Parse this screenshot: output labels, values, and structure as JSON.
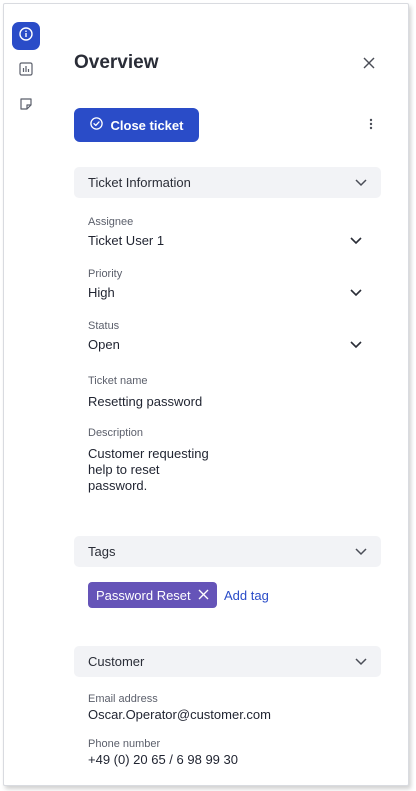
{
  "rail": {
    "items": [
      {
        "icon": "info-icon",
        "active": true
      },
      {
        "icon": "chart-icon",
        "active": false
      },
      {
        "icon": "sticky-note-icon",
        "active": false
      }
    ]
  },
  "panel": {
    "title": "Overview",
    "close_ticket_label": "Close ticket"
  },
  "ticket_information": {
    "heading": "Ticket Information",
    "assignee_label": "Assignee",
    "assignee_value": "Ticket User 1",
    "priority_label": "Priority",
    "priority_value": "High",
    "status_label": "Status",
    "status_value": "Open",
    "ticket_name_label": "Ticket name",
    "ticket_name_value": "Resetting password",
    "description_label": "Description",
    "description_lines": [
      "Customer requesting",
      "help to reset",
      "password."
    ]
  },
  "tags": {
    "heading": "Tags",
    "items": [
      "Password Reset"
    ],
    "add_label": "Add tag"
  },
  "customer": {
    "heading": "Customer",
    "email_label": "Email address",
    "email_value": "Oscar.Operator@customer.com",
    "phone_label": "Phone number",
    "phone_value": "+49 (0) 20 65 / 6 98 99 30"
  },
  "colors": {
    "accent": "#2a4cc8",
    "chip": "#6554b8",
    "section_bg": "#f2f3f6"
  }
}
